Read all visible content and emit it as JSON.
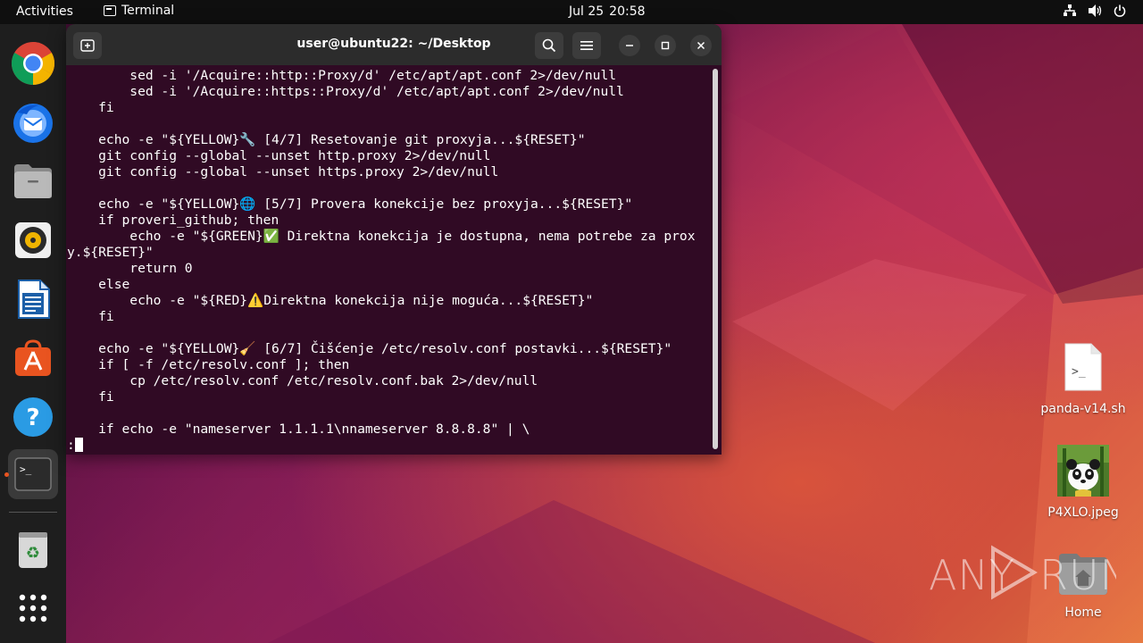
{
  "topbar": {
    "activities": "Activities",
    "app_name": "Terminal",
    "date": "Jul 25",
    "time": "20:58",
    "tray_icons": [
      "network-icon",
      "volume-icon",
      "power-icon"
    ]
  },
  "dock": {
    "items": [
      {
        "name": "chrome",
        "icon": "chrome-icon"
      },
      {
        "name": "thunderbird",
        "icon": "thunderbird-icon"
      },
      {
        "name": "files",
        "icon": "files-icon"
      },
      {
        "name": "rhythmbox",
        "icon": "rhythmbox-icon"
      },
      {
        "name": "writer",
        "icon": "writer-icon"
      },
      {
        "name": "app-center",
        "icon": "app-center-icon"
      },
      {
        "name": "help",
        "icon": "help-icon"
      },
      {
        "name": "terminal",
        "icon": "terminal-icon"
      },
      {
        "name": "trash",
        "icon": "trash-icon"
      },
      {
        "name": "show-apps",
        "icon": "grid-icon"
      }
    ]
  },
  "terminal": {
    "title": "user@ubuntu22: ~/Desktop",
    "lines": [
      "        sed -i '/Acquire::http::Proxy/d' /etc/apt/apt.conf 2>/dev/null",
      "        sed -i '/Acquire::https::Proxy/d' /etc/apt/apt.conf 2>/dev/null",
      "    fi",
      "",
      "    echo -e \"${YELLOW}🔧 [4/7] Resetovanje git proxyja...${RESET}\"",
      "    git config --global --unset http.proxy 2>/dev/null",
      "    git config --global --unset https.proxy 2>/dev/null",
      "",
      "    echo -e \"${YELLOW}🌐 [5/7] Provera konekcije bez proxyja...${RESET}\"",
      "    if proveri_github; then",
      "        echo -e \"${GREEN}✅ Direktna konekcija je dostupna, nema potrebe za prox",
      "y.${RESET}\"",
      "        return 0",
      "    else",
      "        echo -e \"${RED}⚠️Direktna konekcija nije moguća...${RESET}\"",
      "    fi",
      "",
      "    echo -e \"${YELLOW}🧹 [6/7] Čišćenje /etc/resolv.conf postavki...${RESET}\"",
      "    if [ -f /etc/resolv.conf ]; then",
      "        cp /etc/resolv.conf /etc/resolv.conf.bak 2>/dev/null",
      "    fi",
      "",
      "    if echo -e \"nameserver 1.1.1.1\\nnameserver 8.8.8.8\" | \\"
    ],
    "prompt": ":"
  },
  "desktop": {
    "icons": [
      {
        "label": "panda-v14.sh",
        "icon": "shell-script-icon"
      },
      {
        "label": "P4XLO.jpeg",
        "icon": "image-thumbnail-icon"
      },
      {
        "label": "Home",
        "icon": "home-folder-icon"
      }
    ]
  },
  "watermark": "ANY RUN",
  "colors": {
    "terminal_bg": "#300a24",
    "header_bg": "#2c2c2c",
    "dock_bg": "#1e1e1e",
    "accent": "#e95420"
  }
}
